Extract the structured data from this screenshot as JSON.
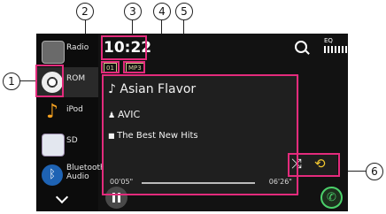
{
  "sidebar": {
    "items": [
      {
        "label": "Radio",
        "icon": "radio-icon"
      },
      {
        "label": "ROM",
        "icon": "disc-icon"
      },
      {
        "label": "iPod",
        "icon": "music-note-icon"
      },
      {
        "label": "SD",
        "icon": "sd-card-icon"
      },
      {
        "label": "Bluetooth\nAudio",
        "icon": "bluetooth-icon"
      }
    ]
  },
  "status": {
    "clock": "10:22",
    "track_badge": "01",
    "format_badge": "MP3"
  },
  "header": {
    "eq_label": "EQ"
  },
  "track": {
    "title": "Asian Flavor",
    "artist": "AVIC",
    "album": "The Best New Hits"
  },
  "progress": {
    "elapsed": "00'05\"",
    "total": "06'26\"",
    "fraction": 0.013
  },
  "callouts": {
    "c1": "1",
    "c2": "2",
    "c3": "3",
    "c4": "4",
    "c5": "5",
    "c6": "6"
  },
  "colors": {
    "accent": "#e32b7c",
    "badge": "#d4c488",
    "phone": "#4bd06a"
  }
}
